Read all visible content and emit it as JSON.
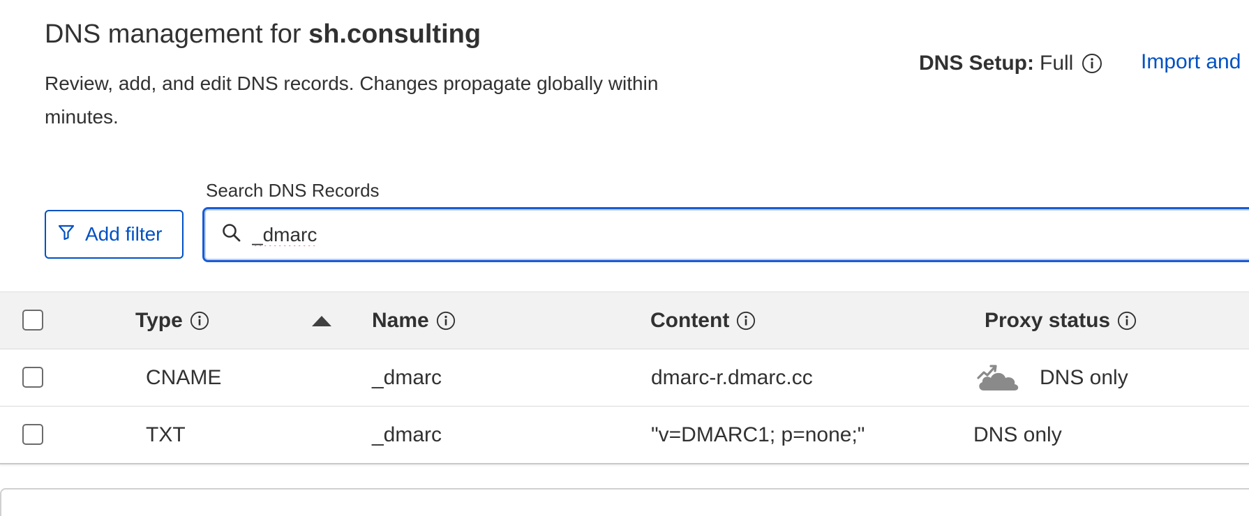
{
  "header": {
    "title_prefix": "DNS management for",
    "zone_name": "sh.consulting",
    "description": "Review, add, and edit DNS records. Changes propagate globally within minutes.",
    "dns_setup_label": "DNS Setup:",
    "dns_setup_value": "Full",
    "import_link": "Import and"
  },
  "search": {
    "label": "Search DNS Records",
    "value": "_dmarc",
    "icon": "search-icon"
  },
  "filter": {
    "add_filter_label": "Add filter",
    "icon": "filter-icon"
  },
  "table": {
    "headers": {
      "type": "Type",
      "name": "Name",
      "content": "Content",
      "proxy_status": "Proxy status"
    },
    "rows": [
      {
        "type": "CNAME",
        "name": "_dmarc",
        "content": "dmarc-r.dmarc.cc",
        "proxy_status": "DNS only",
        "proxy_icon": "dns-only-cloud-icon"
      },
      {
        "type": "TXT",
        "name": "_dmarc",
        "content": "\"v=DMARC1; p=none;\"",
        "proxy_status": "DNS only"
      }
    ]
  },
  "colors": {
    "link_blue": "#0051c3",
    "focus_blue": "#1a5bd6",
    "text": "#313131",
    "header_bg": "#f2f2f2",
    "cloud_gray": "#8a8a8a"
  }
}
